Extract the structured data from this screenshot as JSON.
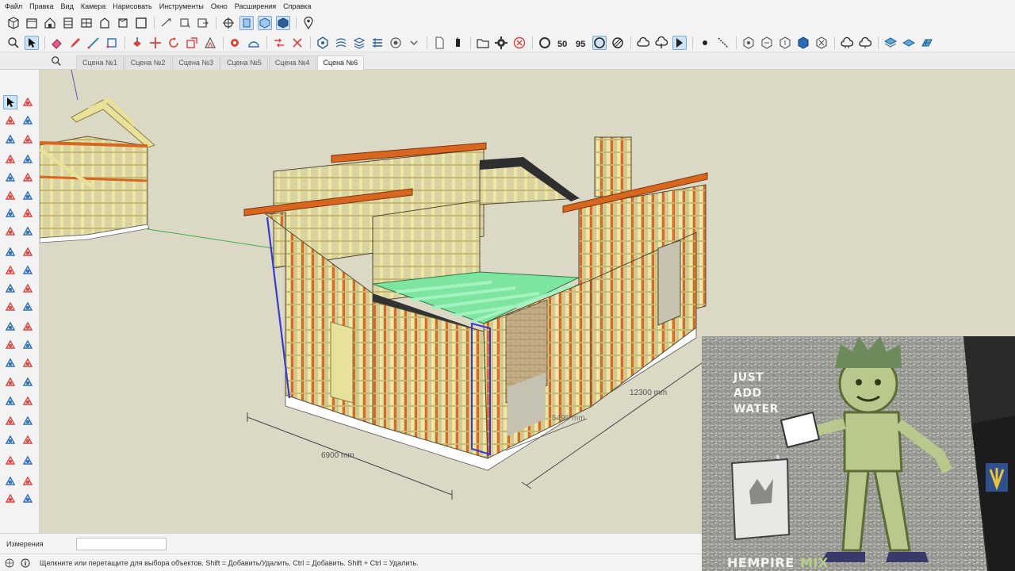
{
  "menu": [
    "Файл",
    "Правка",
    "Вид",
    "Камера",
    "Нарисовать",
    "Инструменты",
    "Окно",
    "Расширения",
    "Справка"
  ],
  "scene_tabs": [
    "Сцена №1",
    "Сцена №2",
    "Сцена №3",
    "Сцена №5",
    "Сцена №4",
    "Сцена №6"
  ],
  "active_tab": "Сцена №6",
  "dimensions": {
    "width": "6900 mm",
    "middle": "5495 mm",
    "length": "12300 mm"
  },
  "measurements": {
    "label": "Измерения",
    "value": ""
  },
  "status": {
    "hint": "Щелкните или перетащите для выбора объектов. Shift = Добавить/Удалить. Ctrl = Добавить. Shift + Ctrl = Удалить."
  },
  "camera_overlay": {
    "text_just": "JUST",
    "text_add": "ADD",
    "text_water": "WATER",
    "brand_hempire": "HEMPIRE",
    "brand_mix": "MIX"
  },
  "colors": {
    "viewport_bg": "#dcd8c6",
    "stud": "#e8e4a0",
    "beam": "#d9661f",
    "floor_joist": "#7de5a0",
    "foundation": "#ffffff",
    "selection_blue": "#3a3acc"
  },
  "icons": {
    "toolbar1": [
      "cube-icon",
      "box-icon",
      "home-icon",
      "door-icon",
      "window-icon",
      "house-outline-icon",
      "box-open-icon",
      "square-icon",
      "dimension-icon",
      "paint-icon",
      "export-icon",
      "orbit-icon",
      "camera-front-icon",
      "camera-iso-icon",
      "camera-side-icon",
      "location-pin-icon"
    ],
    "toolbar2": [
      "search-icon",
      "select-icon",
      "eraser-icon",
      "pencil-icon",
      "line-icon",
      "arc-icon",
      "push-pull-icon",
      "move-icon",
      "rotate-icon",
      "scale-icon",
      "offset-icon",
      "tape-icon",
      "protractor-icon",
      "axes-icon",
      "text-icon",
      "section-icon",
      "component-icon",
      "group-icon",
      "layers-icon",
      "materials-icon",
      "styles-icon",
      "file-icon",
      "settings-icon",
      "delete-icon",
      "round-icon",
      "fifty-icon",
      "ninety-five-icon",
      "circle-select-icon",
      "hatch-icon",
      "cloud-icon",
      "cloud-add-icon",
      "arrow-icon",
      "dot-icon",
      "measure-line-icon",
      "hex1-icon",
      "hex2-icon",
      "hex3-icon",
      "hex4-icon",
      "hex5-icon",
      "cloud2-icon",
      "cloud3-icon",
      "grid1-icon",
      "grid2-icon",
      "grid3-icon"
    ]
  }
}
